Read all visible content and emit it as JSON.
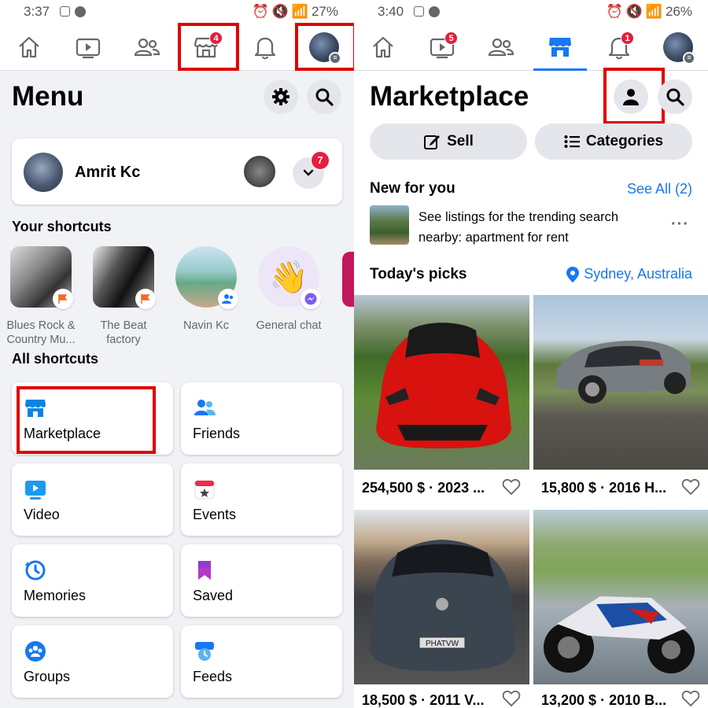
{
  "left": {
    "status": {
      "time": "3:37",
      "battery": "27%"
    },
    "nav": {
      "marketplace_badge": "4"
    },
    "title": "Menu",
    "profile": {
      "name": "Amrit Kc",
      "notif_badge": "7"
    },
    "shortcuts_heading": "Your shortcuts",
    "shortcuts": [
      {
        "line1": "Blues Rock &",
        "line2": "Country Mu..."
      },
      {
        "line1": "The Beat",
        "line2": "factory"
      },
      {
        "line1": "Navin Kc",
        "line2": ""
      },
      {
        "line1": "General chat",
        "line2": ""
      }
    ],
    "all_shortcuts_heading": "All shortcuts",
    "tiles": [
      {
        "label": "Marketplace",
        "icon": "marketplace-icon"
      },
      {
        "label": "Friends",
        "icon": "friends-icon"
      },
      {
        "label": "Video",
        "icon": "video-icon"
      },
      {
        "label": "Events",
        "icon": "events-icon"
      },
      {
        "label": "Memories",
        "icon": "memories-icon"
      },
      {
        "label": "Saved",
        "icon": "saved-icon"
      },
      {
        "label": "Groups",
        "icon": "groups-icon"
      },
      {
        "label": "Feeds",
        "icon": "feeds-icon"
      }
    ]
  },
  "right": {
    "status": {
      "time": "3:40",
      "battery": "26%"
    },
    "nav": {
      "video_badge": "5",
      "notif_badge": "1"
    },
    "title": "Marketplace",
    "sell_label": "Sell",
    "categories_label": "Categories",
    "new_for_you": "New for you",
    "see_all": "See All (2)",
    "suggestion_line1": "See listings for the trending search",
    "suggestion_line2": "nearby: apartment for rent",
    "todays_picks": "Today's picks",
    "location": "Sydney, Australia",
    "listings": [
      {
        "price": "254,500 $ · 2023 ..."
      },
      {
        "price": "15,800 $ · 2016 H..."
      },
      {
        "price": "18,500 $ · 2011 V..."
      },
      {
        "price": "13,200 $ · 2010 B..."
      }
    ],
    "plate_text": "PHATVW"
  },
  "colors": {
    "accent": "#1877f2",
    "highlight": "#e00000",
    "badge": "#e41e3f"
  }
}
